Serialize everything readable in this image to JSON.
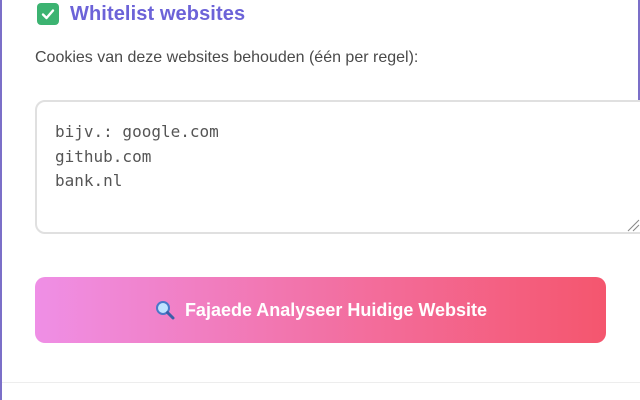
{
  "whitelist": {
    "title": "Whitelist websites",
    "checked": true,
    "description": "Cookies van deze websites behouden (één per regel):",
    "textarea_value": "bijv.: google.com\ngithub.com\nbank.nl"
  },
  "actions": {
    "analyze_button_label": "Fajaede Analyseer Huidige Website",
    "analyze_button_icon": "magnifier-icon"
  },
  "colors": {
    "accent": "#6c63d8",
    "check_green": "#3cb371",
    "button_gradient_start": "#ef8fe6",
    "button_gradient_end": "#f4566e"
  }
}
